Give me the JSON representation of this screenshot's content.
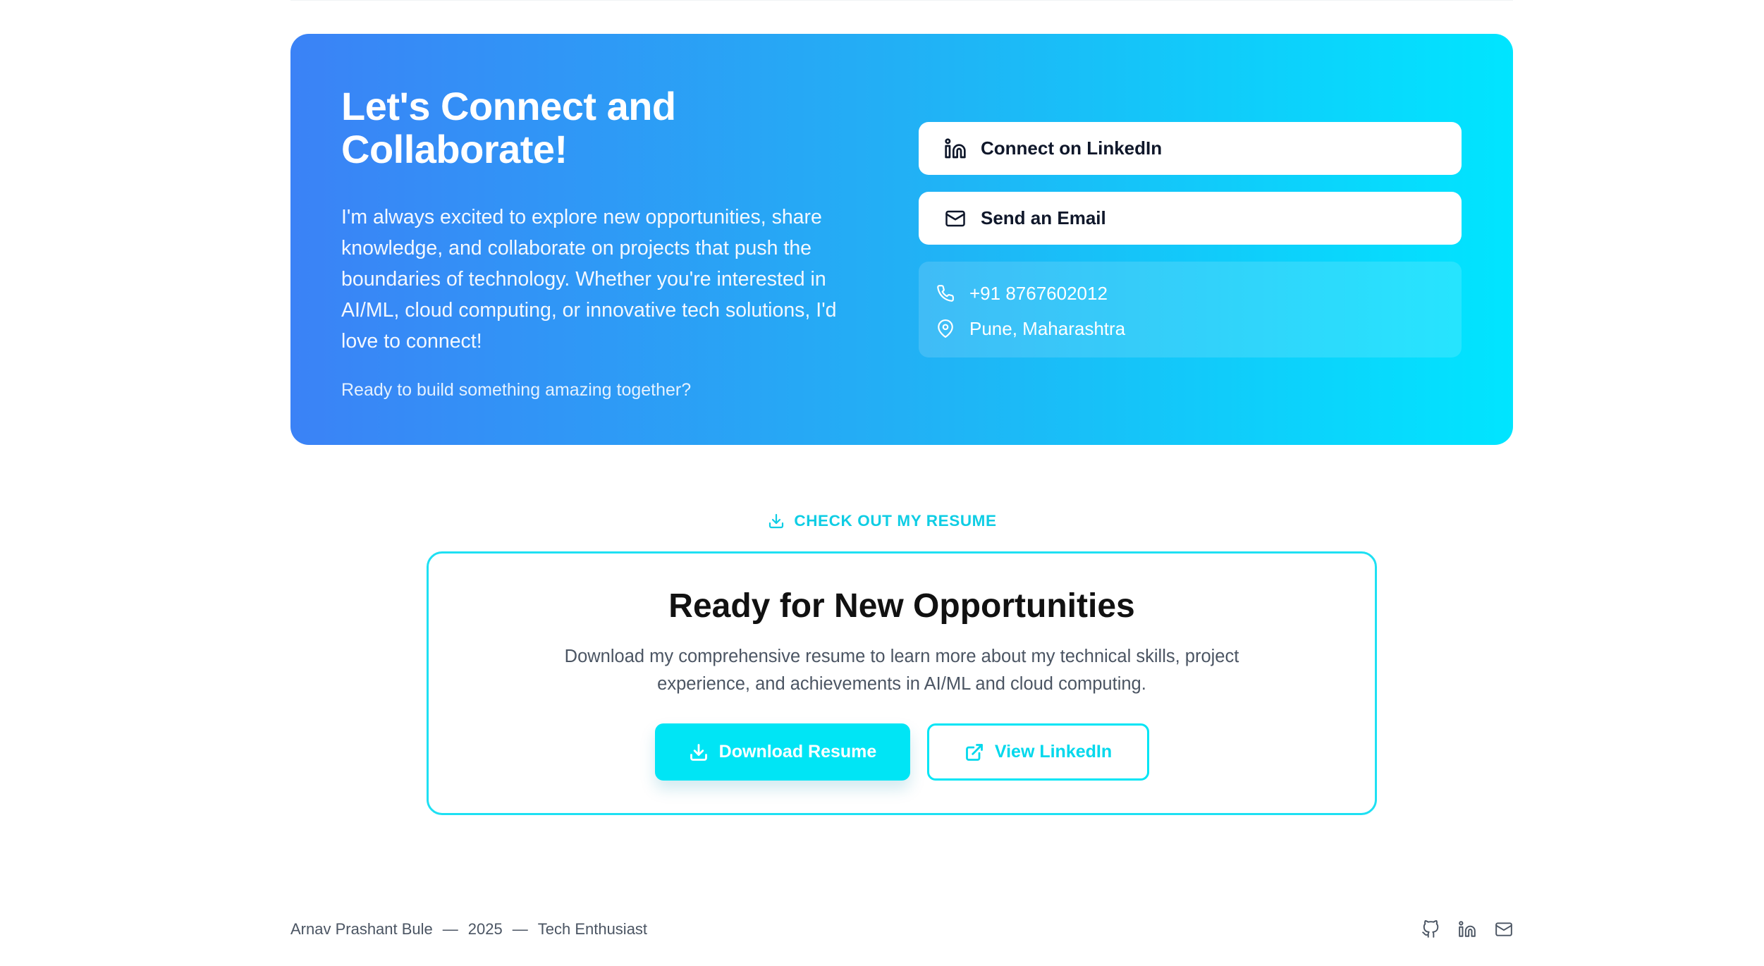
{
  "connect": {
    "title": "Let's Connect and Collaborate!",
    "body": "I'm always excited to explore new opportunities, share knowledge, and collaborate on projects that push the boundaries of technology. Whether you're interested in AI/ML, cloud computing, or innovative tech solutions, I'd love to connect!",
    "tagline": "Ready to build something amazing together?",
    "linkedin_label": "Connect on LinkedIn",
    "email_label": "Send an Email",
    "phone": "+91 8767602012",
    "location": "Pune, Maharashtra",
    "gradient_start": "#3b82f6",
    "gradient_end": "#00e5ff"
  },
  "resume": {
    "eyebrow": "CHECK OUT MY RESUME",
    "title": "Ready for New Opportunities",
    "description": "Download my comprehensive resume to learn more about my technical skills, project experience, and achievements in AI/ML and cloud computing.",
    "download_label": "Download Resume",
    "linkedin_label": "View LinkedIn",
    "accent_color": "#00e5f5"
  },
  "footer": {
    "name": "Arnav Prashant Bule",
    "year": "2025",
    "role": "Tech Enthusiast",
    "separator": "—",
    "icons": [
      "github-icon",
      "linkedin-icon",
      "mail-icon"
    ]
  }
}
